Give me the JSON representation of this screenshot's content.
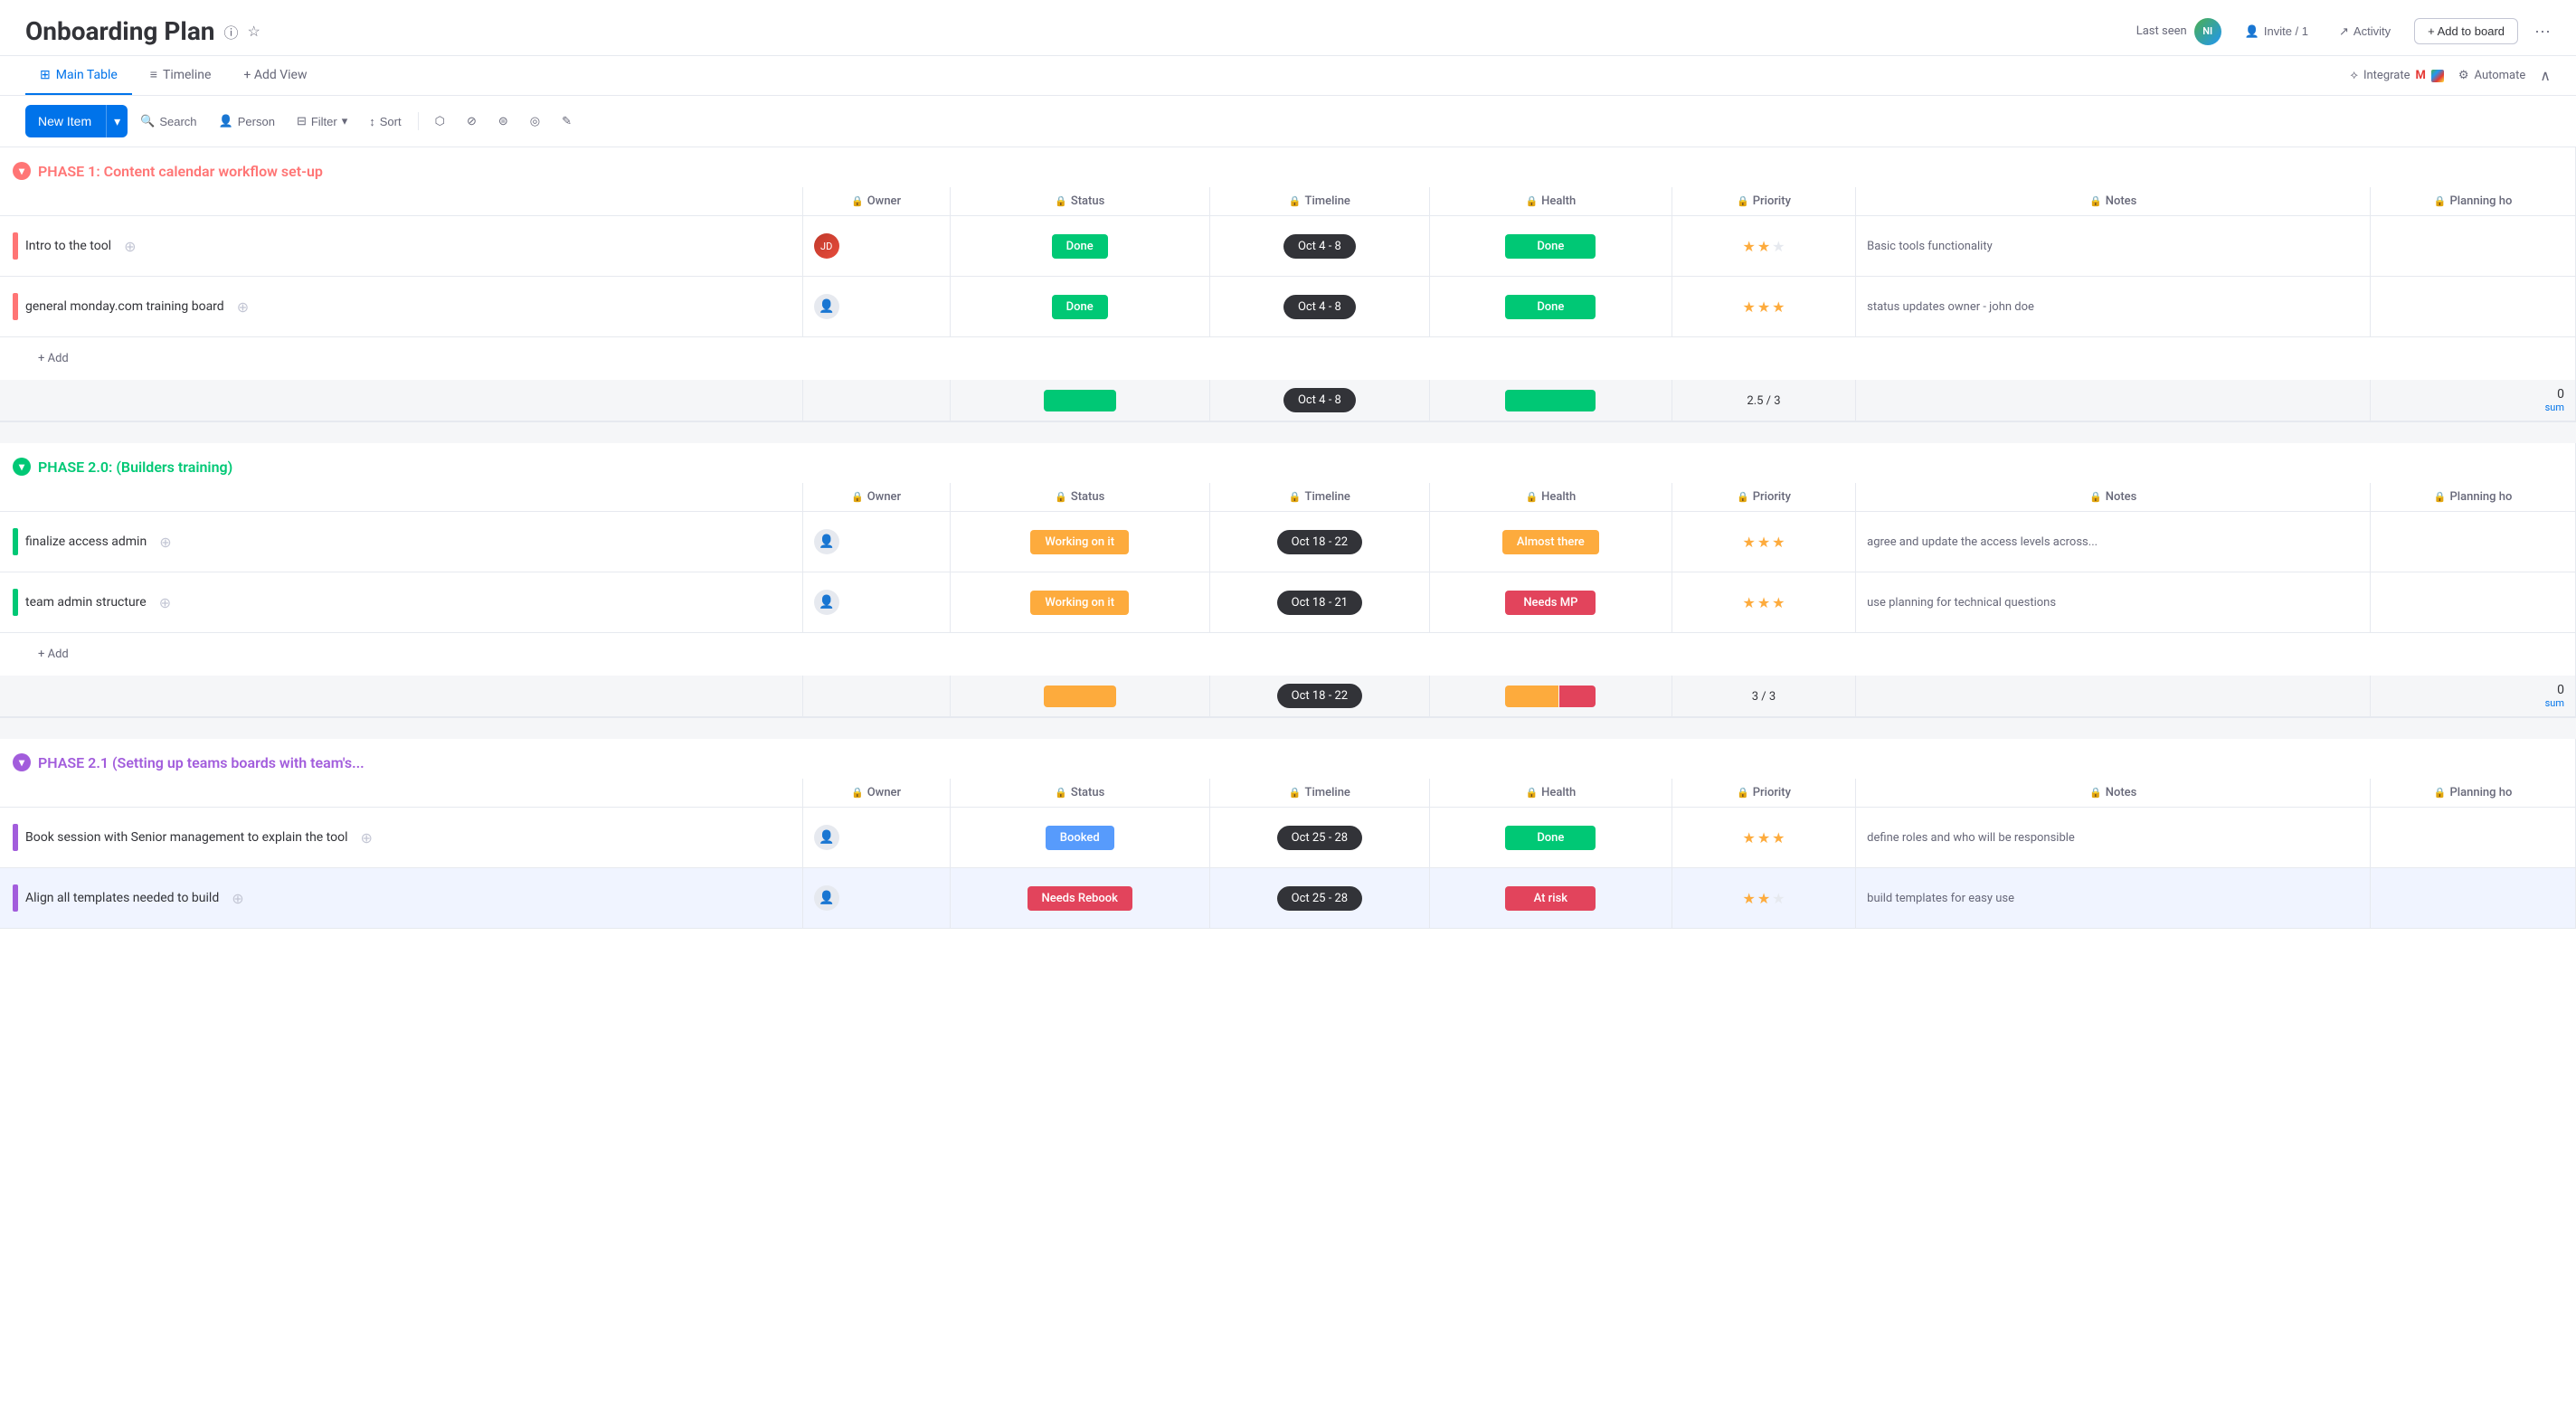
{
  "header": {
    "title": "Onboarding Plan",
    "last_seen_label": "Last seen",
    "invite_label": "Invite / 1",
    "activity_label": "Activity",
    "add_to_board_label": "+ Add to board",
    "more_icon": "···"
  },
  "tabs": {
    "items": [
      {
        "label": "Main Table",
        "icon": "⊞",
        "active": true
      },
      {
        "label": "Timeline",
        "icon": "≡",
        "active": false
      },
      {
        "label": "+ Add View",
        "icon": "",
        "active": false
      }
    ],
    "integrate_label": "Integrate",
    "automate_label": "Automate"
  },
  "toolbar": {
    "new_item_label": "New Item",
    "search_label": "Search",
    "person_label": "Person",
    "filter_label": "Filter",
    "sort_label": "Sort"
  },
  "columns": {
    "owner": "Owner",
    "status": "Status",
    "timeline": "Timeline",
    "health": "Health",
    "priority": "Priority",
    "notes": "Notes",
    "planning": "Planning ho"
  },
  "phases": [
    {
      "id": "phase1",
      "title": "PHASE 1: Content calendar workflow set-up",
      "color": "#ff7575",
      "toggle_color": "pink",
      "items": [
        {
          "name": "Intro to the tool",
          "bar_color": "#ff7575",
          "owner": "avatar",
          "status": "Done",
          "status_type": "done",
          "timeline": "Oct 4 - 8",
          "health": "Done",
          "health_type": "done",
          "priority": 2,
          "max_priority": 3,
          "notes": "Basic tools functionality"
        },
        {
          "name": "general monday.com training board",
          "bar_color": "#ff7575",
          "owner": "empty",
          "status": "Done",
          "status_type": "done",
          "timeline": "Oct 4 - 8",
          "health": "Done",
          "health_type": "done",
          "priority": 3,
          "max_priority": 3,
          "notes": "status updates owner - john doe"
        }
      ],
      "summary": {
        "priority_label": "2.5 / 3",
        "timeline": "Oct 4 - 8",
        "sum_value": "0",
        "sum_label": "sum"
      }
    },
    {
      "id": "phase2",
      "title": "PHASE 2.0: (Builders training)",
      "color": "#00c875",
      "toggle_color": "green",
      "items": [
        {
          "name": "finalize access admin",
          "bar_color": "#00c875",
          "owner": "empty",
          "status": "Working on it",
          "status_type": "working",
          "timeline": "Oct 18 - 22",
          "health": "Almost there",
          "health_type": "almost",
          "priority": 3,
          "max_priority": 3,
          "notes": "agree and update the access levels across..."
        },
        {
          "name": "team admin structure",
          "bar_color": "#00c875",
          "owner": "empty",
          "status": "Working on it",
          "status_type": "working",
          "timeline": "Oct 18 - 21",
          "health": "Needs MP",
          "health_type": "needs-mp",
          "priority": 3,
          "max_priority": 3,
          "notes": "use planning for technical questions"
        }
      ],
      "summary": {
        "priority_label": "3 / 3",
        "timeline": "Oct 18 - 22",
        "sum_value": "0",
        "sum_label": "sum"
      }
    },
    {
      "id": "phase21",
      "title": "PHASE 2.1 (Setting up teams boards with team's...",
      "color": "#a25ddc",
      "toggle_color": "purple",
      "items": [
        {
          "name": "Book session with Senior management to explain the tool",
          "bar_color": "#a25ddc",
          "owner": "empty",
          "status": "Booked",
          "status_type": "booked",
          "timeline": "Oct 25 - 28",
          "health": "Done",
          "health_type": "done",
          "priority": 3,
          "max_priority": 3,
          "notes": "define roles and who will be responsible"
        },
        {
          "name": "Align all templates needed to build",
          "bar_color": "#a25ddc",
          "owner": "empty",
          "status": "Needs Rebook",
          "status_type": "needs-rebook",
          "timeline": "Oct 25 - 28",
          "health": "At risk",
          "health_type": "at-risk",
          "priority": 2,
          "max_priority": 3,
          "notes": "build templates for easy use"
        }
      ],
      "summary": {
        "priority_label": "",
        "timeline": "",
        "sum_value": "",
        "sum_label": ""
      }
    }
  ]
}
